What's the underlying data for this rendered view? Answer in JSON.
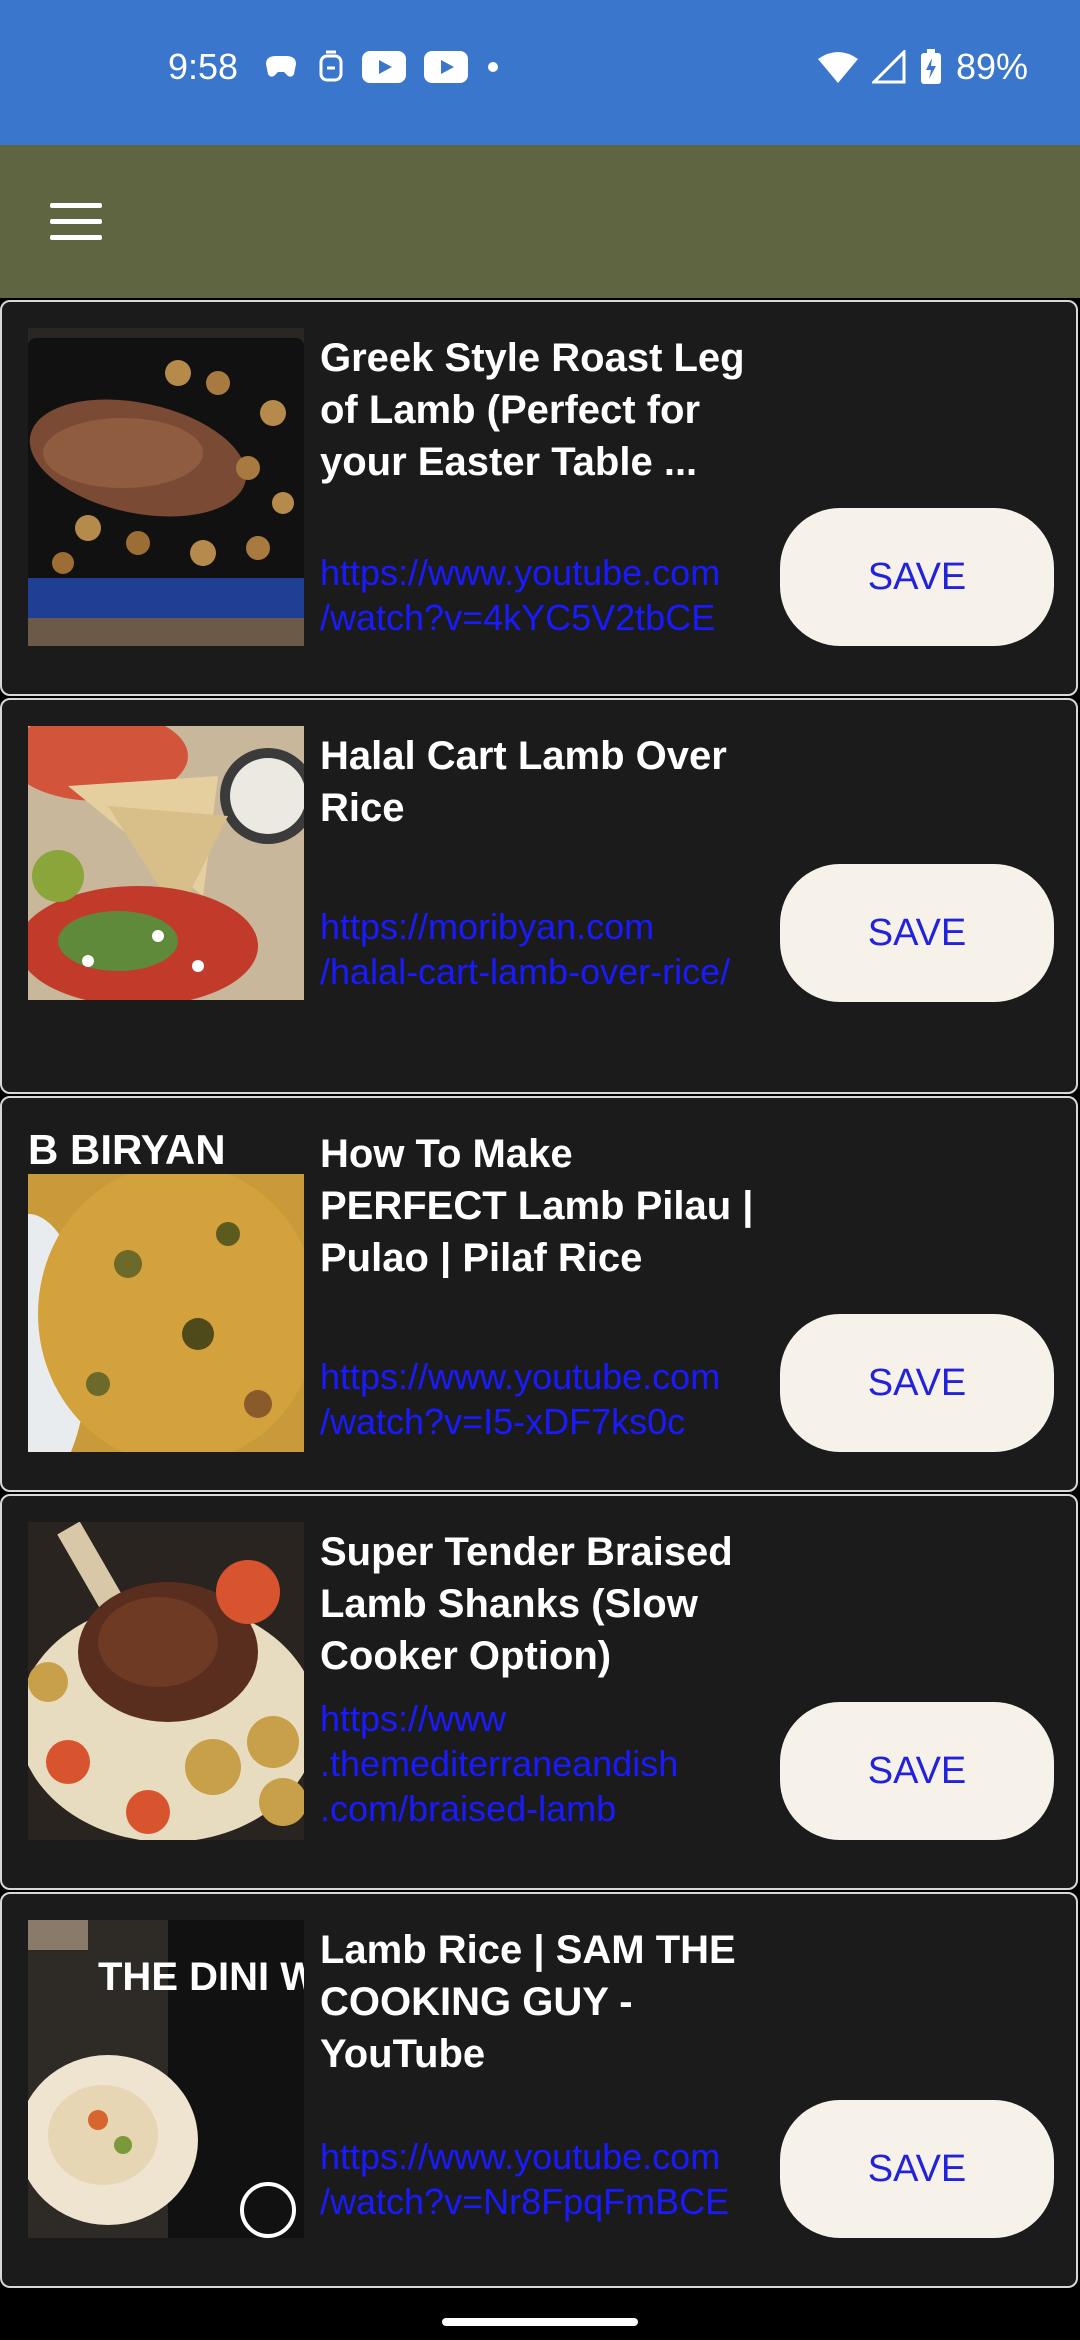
{
  "status": {
    "time": "9:58",
    "battery": "89%",
    "left_icons": [
      "game-controller-cloud-icon",
      "badge-icon",
      "youtube-icon",
      "youtube-icon",
      "dot-icon"
    ],
    "right_icons": [
      "wifi-icon",
      "signal-icon",
      "battery-charging-icon"
    ]
  },
  "app_bar": {
    "menu_icon": "hamburger-menu-icon"
  },
  "recipes": [
    {
      "title": "Greek Style Roast Leg of Lamb (Perfect for your Easter Table ...",
      "url": "https://www.youtube.com\n/watch?v=4kYC5V2tbCE",
      "save_label": "SAVE",
      "thumbnail": "roast-lamb-thumbnail"
    },
    {
      "title": "Halal Cart Lamb Over Rice",
      "url": "https://moribyan.com\n/halal-cart-lamb-over-rice/",
      "save_label": "SAVE",
      "thumbnail": "lamb-over-rice-thumbnail"
    },
    {
      "title": "How To Make PERFECT Lamb Pilau | Pulao | Pilaf Rice Recipe",
      "url": "https://www.youtube.com\n/watch?v=I5-xDF7ks0c",
      "save_label": "SAVE",
      "thumbnail": "lamb-biryani-thumbnail",
      "thumbnail_text": "B BIRYAN"
    },
    {
      "title": "Super Tender Braised Lamb Shanks (Slow Cooker Option)",
      "url": "https://www\n.themediterraneandish\n.com/braised-lamb",
      "save_label": "SAVE",
      "thumbnail": "braised-lamb-shanks-thumbnail"
    },
    {
      "title": "Lamb Rice | SAM THE COOKING GUY - YouTube",
      "url": "https://www.youtube.com\n/watch?v=Nr8FpqFmBCE",
      "save_label": "SAVE",
      "thumbnail": "lamb-rice-sandwich-thumbnail",
      "thumbnail_text": "THE DINI WE CAN MAK"
    }
  ],
  "colors": {
    "status_bar": "#3a76cc",
    "app_bar": "#5f6540",
    "card_bg": "#1b1b1b",
    "link": "#1a1aff",
    "button_bg": "#f6f1e9",
    "button_text": "#2222dd"
  }
}
